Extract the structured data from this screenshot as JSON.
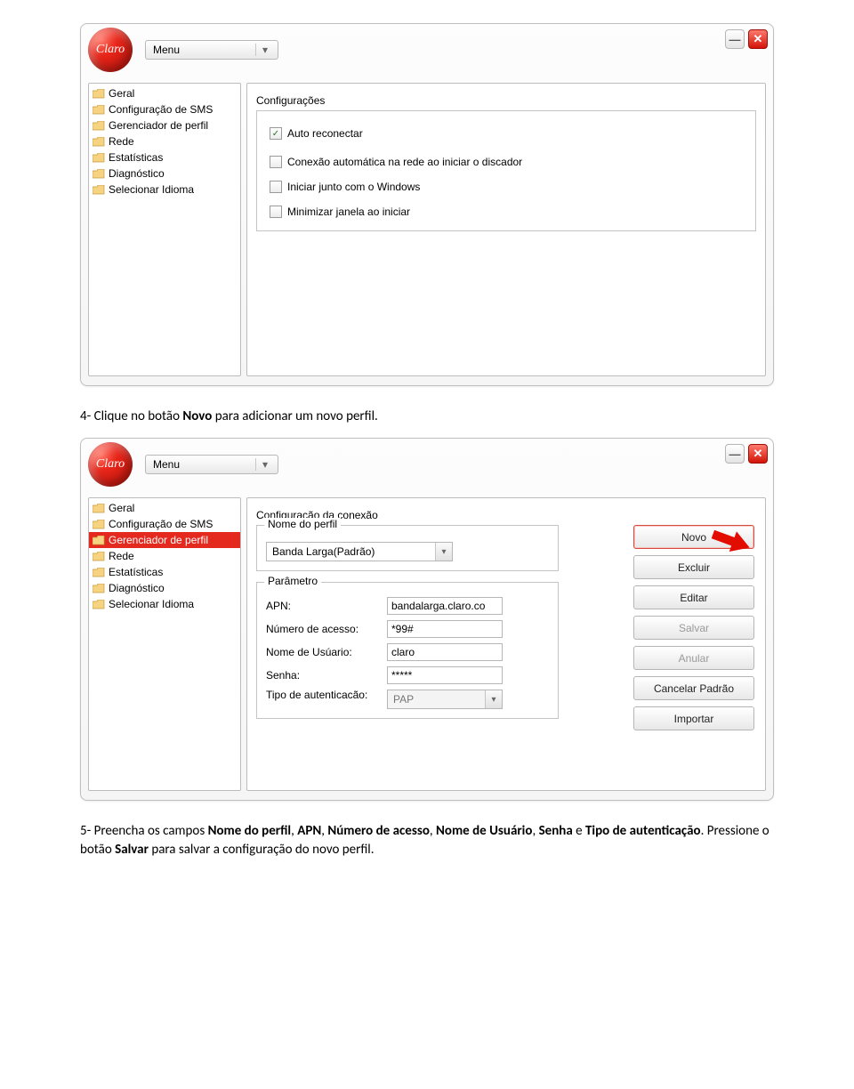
{
  "logo_text": "Claro",
  "menu_label": "Menu",
  "win": {
    "min": "—",
    "close": "✕"
  },
  "sidebar": {
    "items": [
      {
        "label": "Geral"
      },
      {
        "label": "Configuração de SMS"
      },
      {
        "label": "Gerenciador de perfil"
      },
      {
        "label": "Rede"
      },
      {
        "label": "Estatísticas"
      },
      {
        "label": "Diagnóstico"
      },
      {
        "label": "Selecionar Idioma"
      }
    ]
  },
  "screen1": {
    "group_title": "Configurações",
    "checks": [
      {
        "label": "Auto reconectar",
        "checked": true
      },
      {
        "label": "Conexão automática na rede ao iniciar o discador",
        "checked": false
      },
      {
        "label": "Iniciar junto com o Windows",
        "checked": false
      },
      {
        "label": "Minimizar janela ao iniciar",
        "checked": false
      }
    ]
  },
  "instructions": {
    "step4_pre": "4- Clique no botão ",
    "step4_bold": "Novo",
    "step4_post": " para adicionar um novo perfil.",
    "step5_pre": "5- Preencha os campos ",
    "step5_b1": "Nome do perfil",
    "step5_s1": ", ",
    "step5_b2": "APN",
    "step5_s2": ", ",
    "step5_b3": "Número de acesso",
    "step5_s3": ", ",
    "step5_b4": "Nome de Usuário",
    "step5_s4": ", ",
    "step5_b5": "Senha",
    "step5_s5": " e ",
    "step5_b6": "Tipo de autenticação",
    "step5_s6": ". Pressione o botão ",
    "step5_b7": "Salvar",
    "step5_s7": " para salvar a configuração do novo perfil."
  },
  "screen2": {
    "group_title": "Configuração da conexão",
    "profile_group": "Nome do perfil",
    "profile_value": "Banda Larga(Padrão)",
    "param_group": "Parâmetro",
    "labels": {
      "apn": "APN:",
      "numero": "Número de acesso:",
      "usuario": "Nome de Usúario:",
      "senha": "Senha:",
      "auth": "Tipo de autenticacão:"
    },
    "values": {
      "apn": "bandalarga.claro.co",
      "numero": "*99#",
      "usuario": "claro",
      "senha": "*****",
      "auth": "PAP"
    },
    "buttons": {
      "novo": "Novo",
      "excluir": "Excluir",
      "editar": "Editar",
      "salvar": "Salvar",
      "anular": "Anular",
      "cancelar": "Cancelar Padrão",
      "importar": "Importar"
    }
  }
}
